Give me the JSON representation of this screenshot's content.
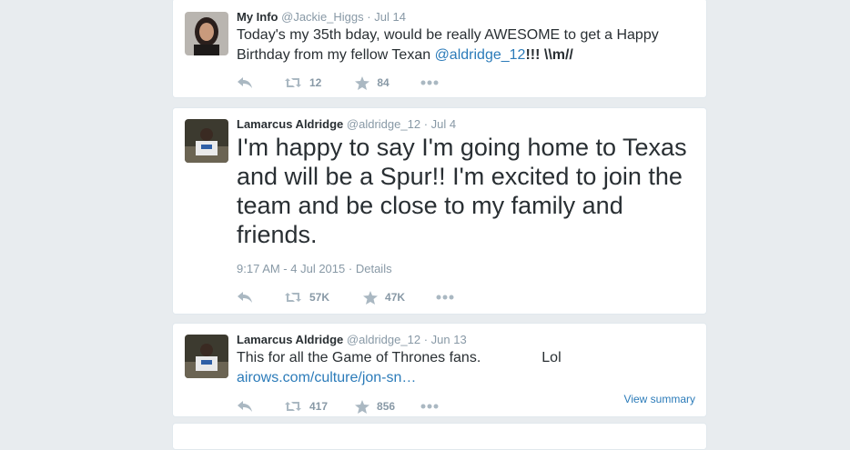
{
  "colors": {
    "link": "#2b7bb9",
    "muted": "#8899a6",
    "icon": "#aab8c2",
    "text": "#292f33",
    "background": "#e8ecef"
  },
  "tweets": [
    {
      "name": "My Info",
      "handle": "@Jackie_Higgs",
      "date": "Jul 14",
      "text_before": "Today's my 35th bday, would be really AWESOME to get a Happy",
      "text_line2_before": "Birthday from my fellow Texan ",
      "mention": "@aldridge_12",
      "text_after": "!!!   \\\\m//",
      "retweets": "12",
      "favorites": "84"
    },
    {
      "name": "Lamarcus Aldridge",
      "handle": "@aldridge_12",
      "date": "Jul 4",
      "lines": [
        "I'm happy to say I'm going home to Texas",
        "and will be a Spur!! I'm excited to join the",
        "team and be close to my family and",
        "friends."
      ],
      "timestamp": "9:17 AM - 4 Jul 2015",
      "details": "Details",
      "retweets": "57K",
      "favorites": "47K"
    },
    {
      "name": "Lamarcus Aldridge",
      "handle": "@aldridge_12",
      "date": "Jun 13",
      "text": "This for all the Game of Thrones fans.",
      "text_extra": "Lol",
      "link": "airows.com/culture/jon-sn…",
      "retweets": "417",
      "favorites": "856",
      "view_summary": "View summary"
    }
  ]
}
